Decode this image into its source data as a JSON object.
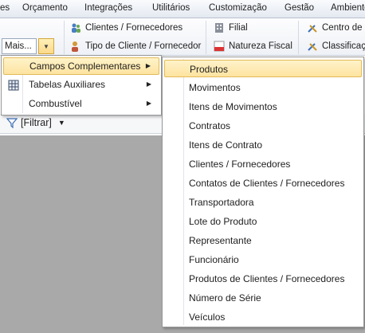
{
  "menubar": {
    "items": [
      "es",
      "Orçamento",
      "Integrações",
      "Utilitários",
      "Customização",
      "Gestão",
      "Ambiente"
    ]
  },
  "ribbon": {
    "clientes_fornecedores": "Clientes / Fornecedores",
    "tipo_cliente": "Tipo de Cliente / Fornecedor",
    "filial": "Filial",
    "natureza_fiscal": "Natureza Fiscal",
    "centro_custo": "Centro de C",
    "classificacao": "Classificaçã",
    "mais": "Mais..."
  },
  "filter": {
    "label": "[Filtrar]"
  },
  "menu1": {
    "items": [
      {
        "label": "Campos Complementares",
        "has_submenu": true,
        "highlighted": true,
        "icon": ""
      },
      {
        "label": "Tabelas Auxiliares",
        "has_submenu": true,
        "highlighted": false,
        "icon": "table-icon"
      },
      {
        "label": "Combustível",
        "has_submenu": true,
        "highlighted": false,
        "icon": ""
      }
    ]
  },
  "menu2": {
    "items": [
      "Produtos",
      "Movimentos",
      "Itens de Movimentos",
      "Contratos",
      "Itens de Contrato",
      "Clientes / Fornecedores",
      "Contatos de Clientes / Fornecedores",
      "Transportadora",
      "Lote do Produto",
      "Representante",
      "Funcionário",
      "Produtos de Clientes / Fornecedores",
      "Número de Série",
      "Veículos"
    ],
    "highlighted_index": 0
  },
  "colors": {
    "highlight": "#fde3a0",
    "highlight_border": "#e3bb58",
    "background": "#a9a9a9"
  }
}
